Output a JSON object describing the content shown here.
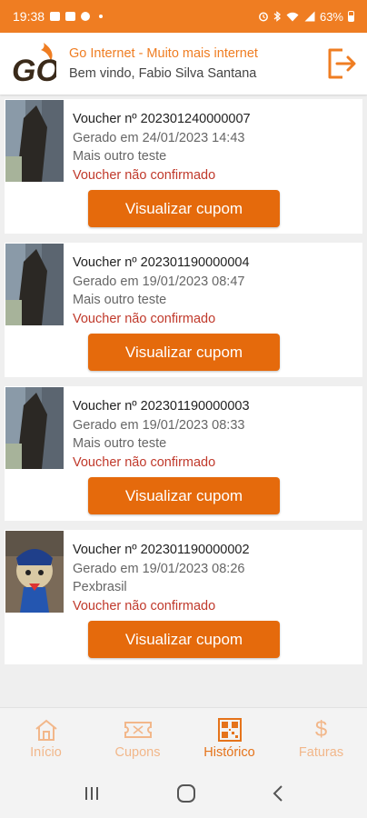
{
  "status_bar": {
    "time": "19:38",
    "battery": "63%"
  },
  "header": {
    "title": "Go Internet - Muito mais internet",
    "welcome": "Bem vindo, Fabio Silva Santana",
    "logo_text": "GO"
  },
  "vouchers": [
    {
      "number": "Voucher nº 202301240000007",
      "generated": "Gerado em 24/01/2023 14:43",
      "description": "Mais outro teste",
      "status": "Voucher não confirmado",
      "button": "Visualizar cupom"
    },
    {
      "number": "Voucher nº 202301190000004",
      "generated": "Gerado em 19/01/2023 08:47",
      "description": "Mais outro teste",
      "status": "Voucher não confirmado",
      "button": "Visualizar cupom"
    },
    {
      "number": "Voucher nº 202301190000003",
      "generated": "Gerado em 19/01/2023 08:33",
      "description": "Mais outro teste",
      "status": "Voucher não confirmado",
      "button": "Visualizar cupom"
    },
    {
      "number": "Voucher nº 202301190000002",
      "generated": "Gerado em 19/01/2023 08:26",
      "description": "Pexbrasil",
      "status": "Voucher não confirmado",
      "button": "Visualizar cupom"
    }
  ],
  "bottom_nav": [
    {
      "label": "Início",
      "icon": "home-icon",
      "active": false
    },
    {
      "label": "Cupons",
      "icon": "ticket-icon",
      "active": false
    },
    {
      "label": "Histórico",
      "icon": "qr-code-icon",
      "active": true
    },
    {
      "label": "Faturas",
      "icon": "dollar-icon",
      "active": false
    }
  ],
  "colors": {
    "brand": "#ef7d22",
    "button": "#e56a0c",
    "status": "#c0392b"
  }
}
